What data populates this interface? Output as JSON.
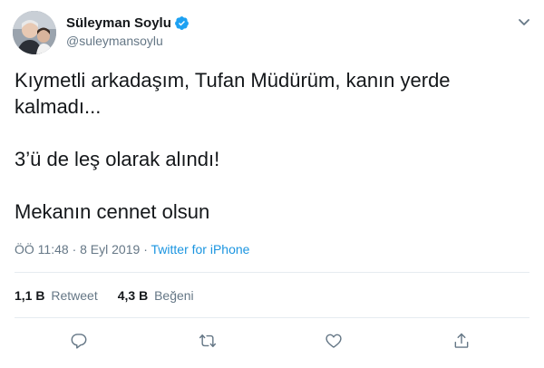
{
  "author": {
    "display_name": "Süleyman Soylu",
    "handle": "@suleymansoylu",
    "verified": true
  },
  "tweet": {
    "lines": [
      "Kıymetli arkadaşım, Tufan Müdürüm, kanın yerde kalmadı...",
      "3’ü de leş olarak alındı!",
      "Mekanın cennet olsun"
    ],
    "time": "ÖÖ 11:48",
    "separator": "·",
    "date": "8 Eyl 2019",
    "source": "Twitter for iPhone"
  },
  "stats": {
    "retweets_count": "1,1 B",
    "retweets_label": "Retweet",
    "likes_count": "4,3 B",
    "likes_label": "Beğeni"
  },
  "icons": {
    "reply": "reply-icon",
    "retweet": "retweet-icon",
    "like": "like-icon",
    "share": "share-icon",
    "more": "chevron-down-icon",
    "verified": "verified-badge-icon"
  },
  "colors": {
    "text": "#14171a",
    "secondary": "#657786",
    "link": "#1b95e0",
    "verified": "#1da1f2",
    "divider": "#e6ecf0"
  }
}
